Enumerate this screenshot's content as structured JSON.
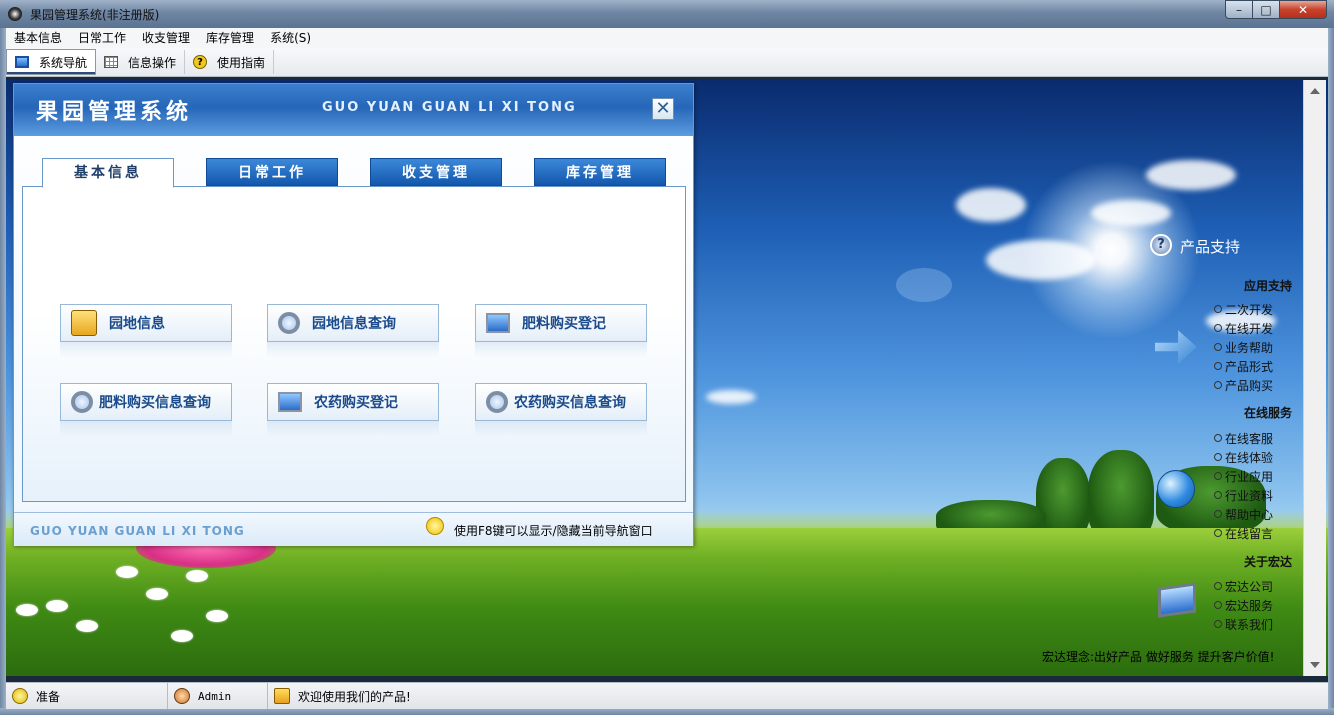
{
  "window": {
    "title": "果园管理系统(非注册版)",
    "controls": {
      "minimize": "–",
      "maximize": "□",
      "close": "✕"
    }
  },
  "menu": {
    "items": [
      "基本信息",
      "日常工作",
      "收支管理",
      "库存管理",
      "系统(S)"
    ]
  },
  "toolbar": {
    "items": [
      {
        "label": "系统导航",
        "icon": "monitor-icon",
        "active": true
      },
      {
        "label": "信息操作",
        "icon": "grid-icon",
        "active": false
      },
      {
        "label": "使用指南",
        "icon": "help-icon",
        "active": false
      }
    ]
  },
  "nav_panel": {
    "title": "果园管理系统",
    "subtitle": "GUO YUAN GUAN LI XI TONG",
    "close": "✕",
    "tabs": [
      {
        "label": "基本信息",
        "active": true
      },
      {
        "label": "日常工作",
        "active": false
      },
      {
        "label": "收支管理",
        "active": false
      },
      {
        "label": "库存管理",
        "active": false
      }
    ],
    "buttons": [
      {
        "label": "园地信息",
        "icon": "document-icon"
      },
      {
        "label": "园地信息查询",
        "icon": "search-icon"
      },
      {
        "label": "肥料购买登记",
        "icon": "computer-icon"
      },
      {
        "label": "肥料购买信息查询",
        "icon": "search-icon"
      },
      {
        "label": "农药购买登记",
        "icon": "computer-icon"
      },
      {
        "label": "农药购买信息查询",
        "icon": "search-icon"
      }
    ],
    "footer_subtitle": "GUO YUAN GUAN LI XI TONG",
    "footer_tip": "使用F8键可以显示/隐藏当前导航窗口"
  },
  "support": {
    "title": "产品支持",
    "help_glyph": "?",
    "sections": [
      {
        "heading": "应用支持",
        "links": [
          "二次开发",
          "在线开发",
          "业务帮助",
          "产品形式",
          "产品购买"
        ]
      },
      {
        "heading": "在线服务",
        "links": [
          "在线客服",
          "在线体验",
          "行业应用",
          "行业资料",
          "帮助中心",
          "在线留言"
        ]
      },
      {
        "heading": "关于宏达",
        "links": [
          "宏达公司",
          "宏达服务",
          "联系我们"
        ]
      }
    ],
    "slogan": "宏达理念:出好产品 做好服务 提升客户价值!"
  },
  "status": {
    "ready": "准备",
    "user": "Admin",
    "welcome": "欢迎使用我们的产品!"
  },
  "colors": {
    "accent": "#1257ad",
    "title_text": "#ffffff",
    "button_text": "#1a4a8a"
  }
}
